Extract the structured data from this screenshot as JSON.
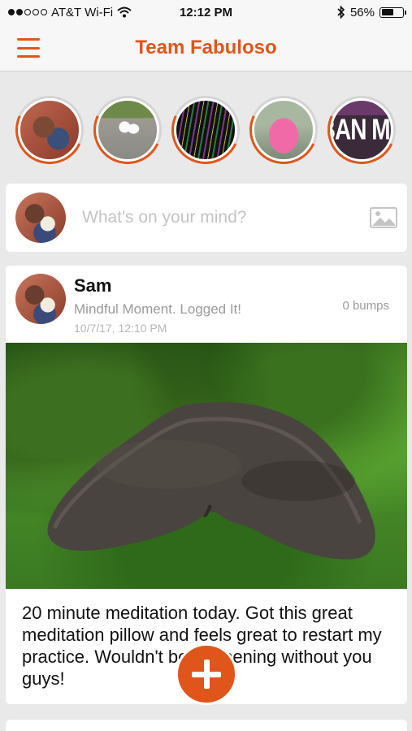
{
  "status_bar": {
    "carrier": "AT&T Wi-Fi",
    "time": "12:12 PM",
    "battery": "56%",
    "battery_level": 0.56
  },
  "nav": {
    "title": "Team Fabuloso",
    "menu_icon": "hamburger-icon"
  },
  "stories": [
    {
      "name": "story-1"
    },
    {
      "name": "story-2"
    },
    {
      "name": "story-3"
    },
    {
      "name": "story-4"
    },
    {
      "name": "story-5",
      "overlay_text": "BAN ME"
    }
  ],
  "composer": {
    "placeholder": "What's on your mind?",
    "icon": "image-icon"
  },
  "post": {
    "author": "Sam",
    "activity": "Mindful Moment. Logged It!",
    "timestamp": "10/7/17, 12:10 PM",
    "bumps": "0 bumps",
    "body": "20 minute meditation today. Got this great meditation pillow and feels great to restart my practice. Wouldn't be happening without you guys!"
  },
  "fab": {
    "icon": "plus-icon",
    "color": "#e0561a"
  },
  "colors": {
    "accent": "#e0561a"
  }
}
